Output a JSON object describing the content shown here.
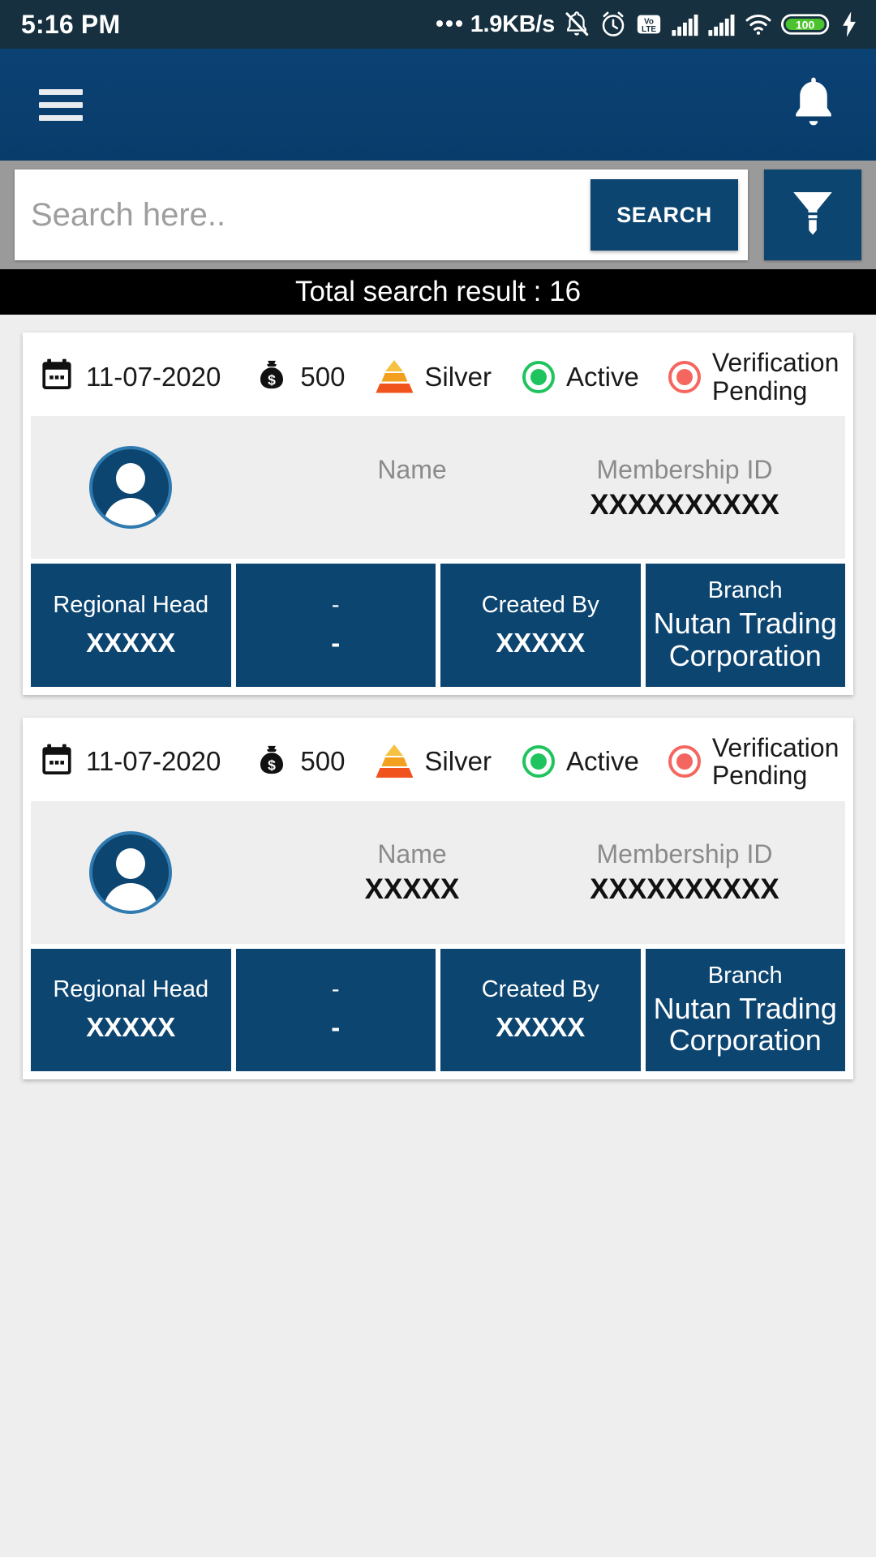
{
  "status_bar": {
    "time": "5:16 PM",
    "net_speed": "1.9KB/s",
    "battery_level": "100",
    "icons": [
      "dots-icon",
      "bell-muted-icon",
      "alarm-clock-icon",
      "volte-icon",
      "signal-bars-icon",
      "signal-bars-icon",
      "wifi-icon",
      "battery-icon",
      "charging-bolt-icon"
    ],
    "volte_top": "Vo",
    "volte_bottom": "LTE"
  },
  "app_bar": {
    "menu_icon": "hamburger-menu-icon",
    "notification_icon": "bell-icon"
  },
  "search": {
    "placeholder": "Search here..",
    "value": "",
    "button_label": "SEARCH",
    "filter_icon": "funnel-filter-icon"
  },
  "results": {
    "banner_text": "Total search result : 16"
  },
  "colors": {
    "app_bar": "#0d4571",
    "status_bar": "#16303f",
    "search_bar": "#9a9a9a",
    "banner": "#000000",
    "tile": "#0d4571",
    "active_green": "#1fc45e",
    "pending_red": "#f4665f",
    "tier_top": "#f5c242",
    "tier_mid": "#f2a01d",
    "tier_bottom": "#f0531c"
  },
  "labels": {
    "name": "Name",
    "membership_id": "Membership ID",
    "regional_head": "Regional Head",
    "blank": "-",
    "created_by": "Created By",
    "branch": "Branch"
  },
  "cards": [
    {
      "date": "11-07-2020",
      "amount": "500",
      "tier": "Silver",
      "status": "Active",
      "verification": "Verification Pending",
      "name": "",
      "membership_id": "XXXXXXXXXX",
      "regional_head": "XXXXX",
      "second_value": "-",
      "created_by": "XXXXX",
      "branch": "Nutan Trading Corporation"
    },
    {
      "date": "11-07-2020",
      "amount": "500",
      "tier": "Silver",
      "status": "Active",
      "verification": "Verification Pending",
      "name": "XXXXX",
      "membership_id": "XXXXXXXXXX",
      "regional_head": "XXXXX",
      "second_value": "-",
      "created_by": "XXXXX",
      "branch": "Nutan Trading Corporation"
    }
  ]
}
